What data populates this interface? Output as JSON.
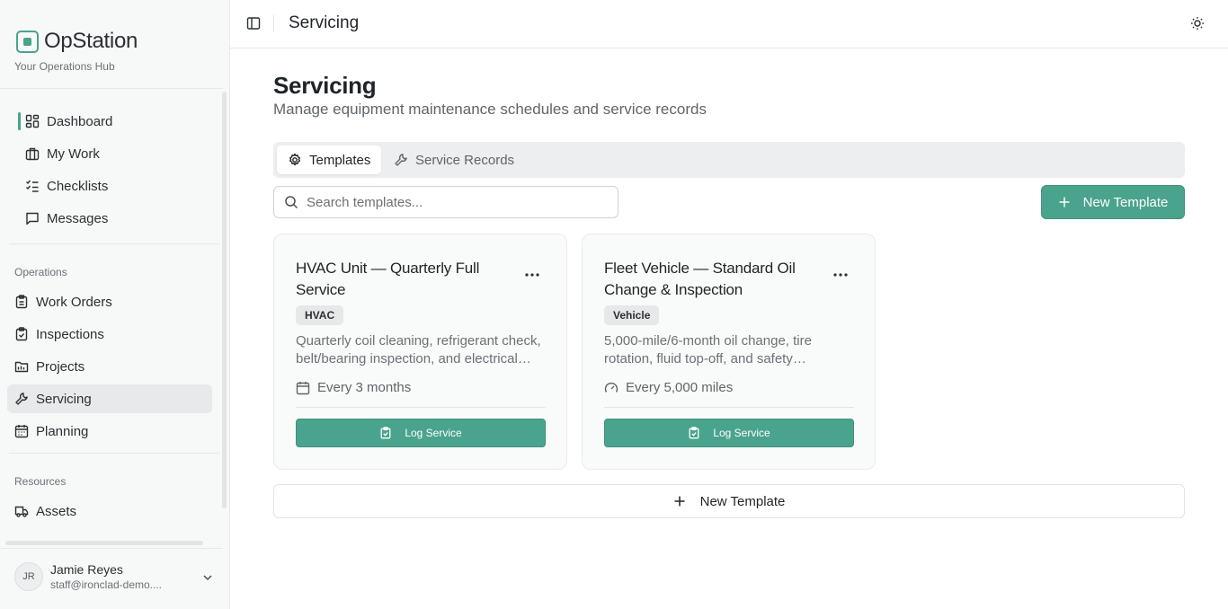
{
  "brand": {
    "name": "OpStation",
    "tagline": "Your Operations Hub"
  },
  "colors": {
    "accent": "#4aa38c",
    "sidebar_bg": "#f7f8f8",
    "active_bg": "#e7e9ea"
  },
  "sidebar": {
    "top_items": [
      {
        "label": "Dashboard",
        "icon": "dashboard-grid-icon",
        "active_marker": true
      },
      {
        "label": "My Work",
        "icon": "briefcase-icon"
      },
      {
        "label": "Checklists",
        "icon": "checklist-icon"
      },
      {
        "label": "Messages",
        "icon": "message-square-icon"
      }
    ],
    "operations_label": "Operations",
    "operations_items": [
      {
        "label": "Work Orders",
        "icon": "clipboard-icon"
      },
      {
        "label": "Inspections",
        "icon": "clipboard-check-icon"
      },
      {
        "label": "Projects",
        "icon": "folder-icon"
      },
      {
        "label": "Servicing",
        "icon": "wrench-icon",
        "selected": true
      },
      {
        "label": "Planning",
        "icon": "calendar-grid-icon"
      }
    ],
    "resources_label": "Resources",
    "resources_items": [
      {
        "label": "Assets",
        "icon": "truck-icon"
      }
    ]
  },
  "user": {
    "initials": "JR",
    "name": "Jamie Reyes",
    "email": "staff@ironclad-demo...."
  },
  "topbar": {
    "title": "Servicing"
  },
  "page": {
    "title": "Servicing",
    "subtitle": "Manage equipment maintenance schedules and service records"
  },
  "tabs": [
    {
      "label": "Templates",
      "icon": "gear-icon",
      "active": true
    },
    {
      "label": "Service Records",
      "icon": "wrench-icon",
      "active": false
    }
  ],
  "search": {
    "placeholder": "Search templates...",
    "value": ""
  },
  "new_template_label": "New Template",
  "templates": [
    {
      "title": "HVAC Unit — Quarterly Full Service",
      "badge": "HVAC",
      "description": "Quarterly coil cleaning, refrigerant check, belt/bearing inspection, and electrical…",
      "frequency": "Every 3 months",
      "frequency_icon": "calendar-icon",
      "action": "Log Service"
    },
    {
      "title": "Fleet Vehicle — Standard Oil Change & Inspection",
      "badge": "Vehicle",
      "description": "5,000-mile/6-month oil change, tire rotation, fluid top-off, and safety…",
      "frequency": "Every 5,000 miles",
      "frequency_icon": "gauge-icon",
      "action": "Log Service"
    }
  ],
  "bottom_new_label": "New Template"
}
